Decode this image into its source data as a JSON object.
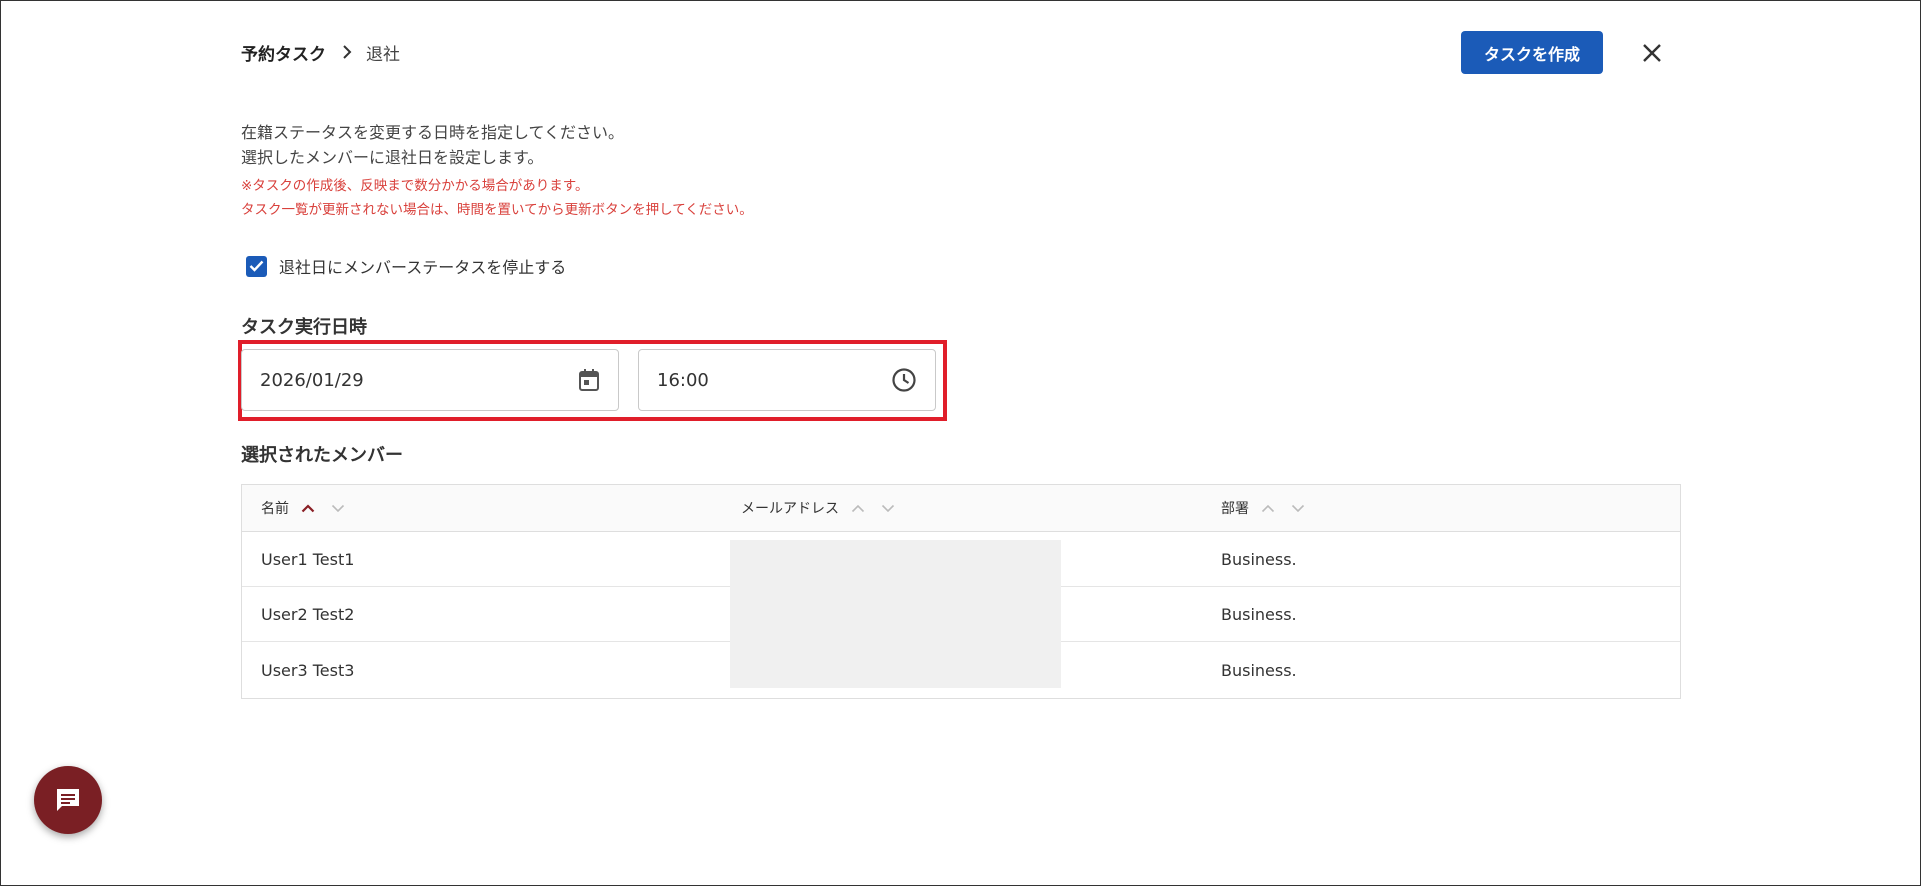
{
  "breadcrumb": {
    "root": "予約タスク",
    "current": "退社"
  },
  "header": {
    "create_button": "タスクを作成"
  },
  "description": {
    "line1": "在籍ステータスを変更する日時を指定してください。",
    "line2": "選択したメンバーに退社日を設定します。",
    "note1": "※タスクの作成後、反映まで数分かかる場合があります。",
    "note2": "タスク一覧が更新されない場合は、時間を置いてから更新ボタンを押してください。"
  },
  "checkbox": {
    "label": "退社日にメンバーステータスを停止する",
    "checked": true
  },
  "datetime": {
    "title": "タスク実行日時",
    "date": "2026/01/29",
    "time": "16:00"
  },
  "members": {
    "title": "選択されたメンバー",
    "columns": [
      "名前",
      "メールアドレス",
      "部署"
    ],
    "rows": [
      {
        "name": "User1 Test1",
        "dept": "Business."
      },
      {
        "name": "User2 Test2",
        "dept": "Business."
      },
      {
        "name": "User3 Test3",
        "dept": "Business."
      }
    ]
  },
  "colors": {
    "primary": "#1b5bb8",
    "note": "#d9413c",
    "highlight": "#e01e2a",
    "fab": "#7a1f24"
  }
}
